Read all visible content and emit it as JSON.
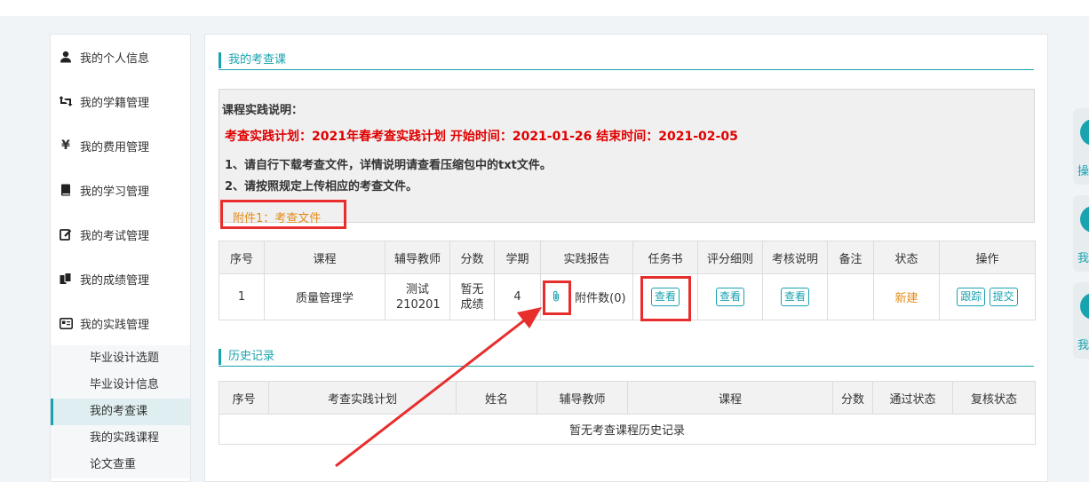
{
  "sidebar": {
    "items": [
      {
        "label": "我的个人信息",
        "icon": "user-icon"
      },
      {
        "label": "我的学籍管理",
        "icon": "retweet-icon"
      },
      {
        "label": "我的费用管理",
        "icon": "yen-icon"
      },
      {
        "label": "我的学习管理",
        "icon": "book-icon"
      },
      {
        "label": "我的考试管理",
        "icon": "edit-icon"
      },
      {
        "label": "我的成绩管理",
        "icon": "copy-icon"
      },
      {
        "label": "我的实践管理",
        "icon": "id-card-icon"
      }
    ],
    "sub_items": [
      {
        "label": "毕业设计选题"
      },
      {
        "label": "毕业设计信息"
      },
      {
        "label": "我的考查课",
        "active": true
      },
      {
        "label": "我的实践课程"
      },
      {
        "label": "论文查重"
      }
    ]
  },
  "main": {
    "section_title": "我的考查课",
    "notice": {
      "heading": "课程实践说明：",
      "plan_line": "考查实践计划：2021年春考查实践计划  开始时间：2021-01-26  结束时间：2021-02-05",
      "step1": "1、请自行下载考查文件，详情说明请查看压缩包中的txt文件。",
      "step2": "2、请按照规定上传相应的考查文件。",
      "attachment": "附件1：考查文件"
    },
    "course_table": {
      "headers": [
        "序号",
        "课程",
        "辅导教师",
        "分数",
        "学期",
        "实践报告",
        "任务书",
        "评分细则",
        "考核说明",
        "备注",
        "状态",
        "操作"
      ],
      "row": {
        "index": "1",
        "course": "质量管理学",
        "teacher": "测试 210201",
        "score": "暂无 成绩",
        "term": "4",
        "report_count": "附件数(0)",
        "task_btn": "查看",
        "rubric_btn": "查看",
        "exam_btn": "查看",
        "note": "",
        "status": "新建",
        "track_btn": "跟踪",
        "submit_btn": "提交"
      }
    },
    "history_title": "历史记录",
    "history_table": {
      "headers": [
        "序号",
        "考查实践计划",
        "姓名",
        "辅导教师",
        "课程",
        "分数",
        "通过状态",
        "复核状态"
      ],
      "empty": "暂无考查课程历史记录"
    }
  },
  "right_widgets": [
    {
      "label": "操"
    },
    {
      "label": "我"
    },
    {
      "label": "我"
    }
  ],
  "colors": {
    "accent": "#18a3b0",
    "highlight": "#e82d2d",
    "warning_text": "#e00000",
    "status_new": "#e38b17"
  }
}
